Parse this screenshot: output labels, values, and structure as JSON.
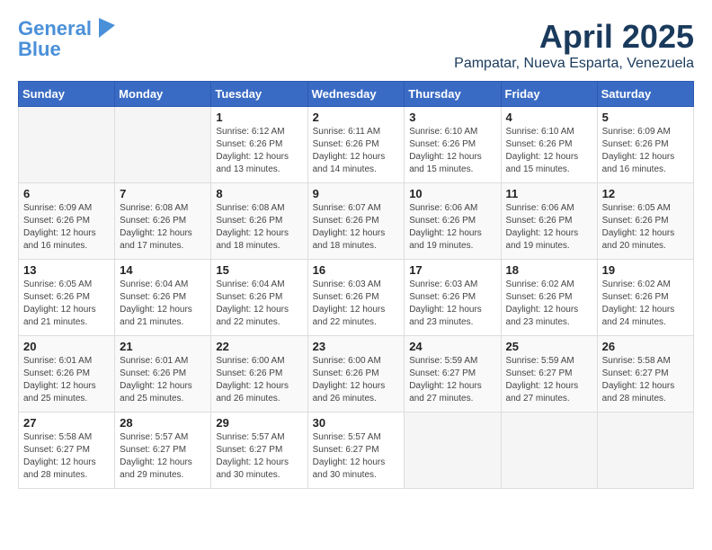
{
  "header": {
    "logo_line1": "General",
    "logo_line2": "Blue",
    "month_title": "April 2025",
    "subtitle": "Pampatar, Nueva Esparta, Venezuela"
  },
  "days_of_week": [
    "Sunday",
    "Monday",
    "Tuesday",
    "Wednesday",
    "Thursday",
    "Friday",
    "Saturday"
  ],
  "weeks": [
    [
      {
        "day": "",
        "info": ""
      },
      {
        "day": "",
        "info": ""
      },
      {
        "day": "1",
        "info": "Sunrise: 6:12 AM\nSunset: 6:26 PM\nDaylight: 12 hours and 13 minutes."
      },
      {
        "day": "2",
        "info": "Sunrise: 6:11 AM\nSunset: 6:26 PM\nDaylight: 12 hours and 14 minutes."
      },
      {
        "day": "3",
        "info": "Sunrise: 6:10 AM\nSunset: 6:26 PM\nDaylight: 12 hours and 15 minutes."
      },
      {
        "day": "4",
        "info": "Sunrise: 6:10 AM\nSunset: 6:26 PM\nDaylight: 12 hours and 15 minutes."
      },
      {
        "day": "5",
        "info": "Sunrise: 6:09 AM\nSunset: 6:26 PM\nDaylight: 12 hours and 16 minutes."
      }
    ],
    [
      {
        "day": "6",
        "info": "Sunrise: 6:09 AM\nSunset: 6:26 PM\nDaylight: 12 hours and 16 minutes."
      },
      {
        "day": "7",
        "info": "Sunrise: 6:08 AM\nSunset: 6:26 PM\nDaylight: 12 hours and 17 minutes."
      },
      {
        "day": "8",
        "info": "Sunrise: 6:08 AM\nSunset: 6:26 PM\nDaylight: 12 hours and 18 minutes."
      },
      {
        "day": "9",
        "info": "Sunrise: 6:07 AM\nSunset: 6:26 PM\nDaylight: 12 hours and 18 minutes."
      },
      {
        "day": "10",
        "info": "Sunrise: 6:06 AM\nSunset: 6:26 PM\nDaylight: 12 hours and 19 minutes."
      },
      {
        "day": "11",
        "info": "Sunrise: 6:06 AM\nSunset: 6:26 PM\nDaylight: 12 hours and 19 minutes."
      },
      {
        "day": "12",
        "info": "Sunrise: 6:05 AM\nSunset: 6:26 PM\nDaylight: 12 hours and 20 minutes."
      }
    ],
    [
      {
        "day": "13",
        "info": "Sunrise: 6:05 AM\nSunset: 6:26 PM\nDaylight: 12 hours and 21 minutes."
      },
      {
        "day": "14",
        "info": "Sunrise: 6:04 AM\nSunset: 6:26 PM\nDaylight: 12 hours and 21 minutes."
      },
      {
        "day": "15",
        "info": "Sunrise: 6:04 AM\nSunset: 6:26 PM\nDaylight: 12 hours and 22 minutes."
      },
      {
        "day": "16",
        "info": "Sunrise: 6:03 AM\nSunset: 6:26 PM\nDaylight: 12 hours and 22 minutes."
      },
      {
        "day": "17",
        "info": "Sunrise: 6:03 AM\nSunset: 6:26 PM\nDaylight: 12 hours and 23 minutes."
      },
      {
        "day": "18",
        "info": "Sunrise: 6:02 AM\nSunset: 6:26 PM\nDaylight: 12 hours and 23 minutes."
      },
      {
        "day": "19",
        "info": "Sunrise: 6:02 AM\nSunset: 6:26 PM\nDaylight: 12 hours and 24 minutes."
      }
    ],
    [
      {
        "day": "20",
        "info": "Sunrise: 6:01 AM\nSunset: 6:26 PM\nDaylight: 12 hours and 25 minutes."
      },
      {
        "day": "21",
        "info": "Sunrise: 6:01 AM\nSunset: 6:26 PM\nDaylight: 12 hours and 25 minutes."
      },
      {
        "day": "22",
        "info": "Sunrise: 6:00 AM\nSunset: 6:26 PM\nDaylight: 12 hours and 26 minutes."
      },
      {
        "day": "23",
        "info": "Sunrise: 6:00 AM\nSunset: 6:26 PM\nDaylight: 12 hours and 26 minutes."
      },
      {
        "day": "24",
        "info": "Sunrise: 5:59 AM\nSunset: 6:27 PM\nDaylight: 12 hours and 27 minutes."
      },
      {
        "day": "25",
        "info": "Sunrise: 5:59 AM\nSunset: 6:27 PM\nDaylight: 12 hours and 27 minutes."
      },
      {
        "day": "26",
        "info": "Sunrise: 5:58 AM\nSunset: 6:27 PM\nDaylight: 12 hours and 28 minutes."
      }
    ],
    [
      {
        "day": "27",
        "info": "Sunrise: 5:58 AM\nSunset: 6:27 PM\nDaylight: 12 hours and 28 minutes."
      },
      {
        "day": "28",
        "info": "Sunrise: 5:57 AM\nSunset: 6:27 PM\nDaylight: 12 hours and 29 minutes."
      },
      {
        "day": "29",
        "info": "Sunrise: 5:57 AM\nSunset: 6:27 PM\nDaylight: 12 hours and 30 minutes."
      },
      {
        "day": "30",
        "info": "Sunrise: 5:57 AM\nSunset: 6:27 PM\nDaylight: 12 hours and 30 minutes."
      },
      {
        "day": "",
        "info": ""
      },
      {
        "day": "",
        "info": ""
      },
      {
        "day": "",
        "info": ""
      }
    ]
  ]
}
